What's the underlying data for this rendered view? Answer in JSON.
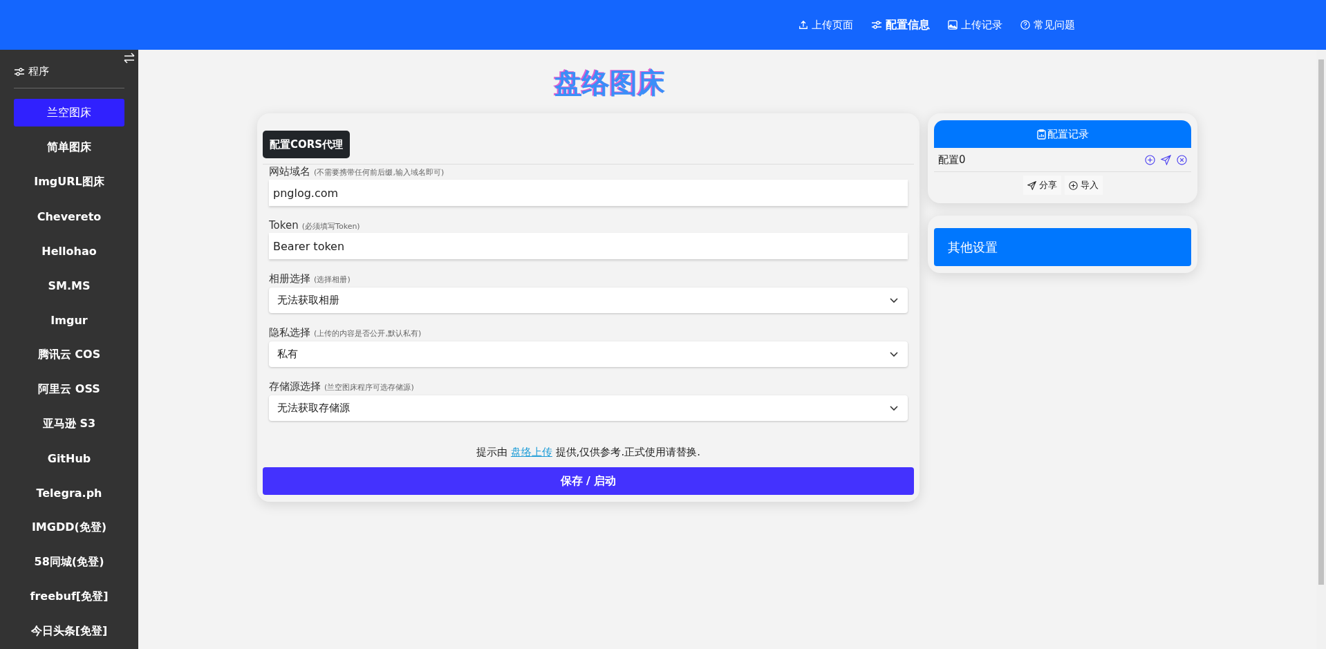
{
  "nav": [
    {
      "kind": "upload",
      "label": "上传页面",
      "selected": false
    },
    {
      "kind": "config",
      "label": "配置信息",
      "selected": true
    },
    {
      "kind": "image",
      "label": "上传记录",
      "selected": false
    },
    {
      "kind": "help",
      "label": "常见问题",
      "selected": false
    }
  ],
  "sidebar": {
    "title": "程序",
    "items": [
      {
        "label": "兰空图床",
        "selected": true
      },
      {
        "label": "简单图床",
        "selected": false
      },
      {
        "label": "ImgURL图床",
        "selected": false
      },
      {
        "label": "Chevereto",
        "selected": false
      },
      {
        "label": "Hellohao",
        "selected": false
      },
      {
        "label": "SM.MS",
        "selected": false
      },
      {
        "label": "Imgur",
        "selected": false
      },
      {
        "label": "腾讯云 COS",
        "selected": false
      },
      {
        "label": "阿里云 OSS",
        "selected": false
      },
      {
        "label": "亚马逊 S3",
        "selected": false
      },
      {
        "label": "GitHub",
        "selected": false
      },
      {
        "label": "Telegra.ph",
        "selected": false
      },
      {
        "label": "IMGDD(免登)",
        "selected": false
      },
      {
        "label": "58同城(免登)",
        "selected": false
      },
      {
        "label": "freebuf[免登]",
        "selected": false
      },
      {
        "label": "今日头条[免登]",
        "selected": false
      }
    ]
  },
  "title": "盘络图床",
  "form": {
    "cors_button": "配置CORS代理",
    "fields": [
      {
        "kind": "input",
        "label": "网站域名",
        "hint": "(不需要携带任何前后缀,输入域名即可)",
        "value": "pnglog.com"
      },
      {
        "kind": "input",
        "label": "Token",
        "hint": "(必须填写Token)",
        "value": "Bearer token"
      },
      {
        "kind": "select",
        "label": "相册选择",
        "hint": "(选择相册)",
        "value": "无法获取相册"
      },
      {
        "kind": "select",
        "label": "隐私选择",
        "hint": "(上传的内容是否公开,默认私有)",
        "value": "私有"
      },
      {
        "kind": "select",
        "label": "存储源选择",
        "hint": "(兰空图床程序可选存储源)",
        "value": "无法获取存储源"
      }
    ],
    "note_before": "提示由",
    "note_link": "盘络上传",
    "note_after": "提供,仅供参考.正式使用请替换.",
    "save_button": "保存 / 启动"
  },
  "records": {
    "title": "配置记录",
    "items": [
      {
        "name": "配置0"
      }
    ],
    "share_button": "分享",
    "import_button": "导入"
  },
  "other_settings": "其他设置"
}
